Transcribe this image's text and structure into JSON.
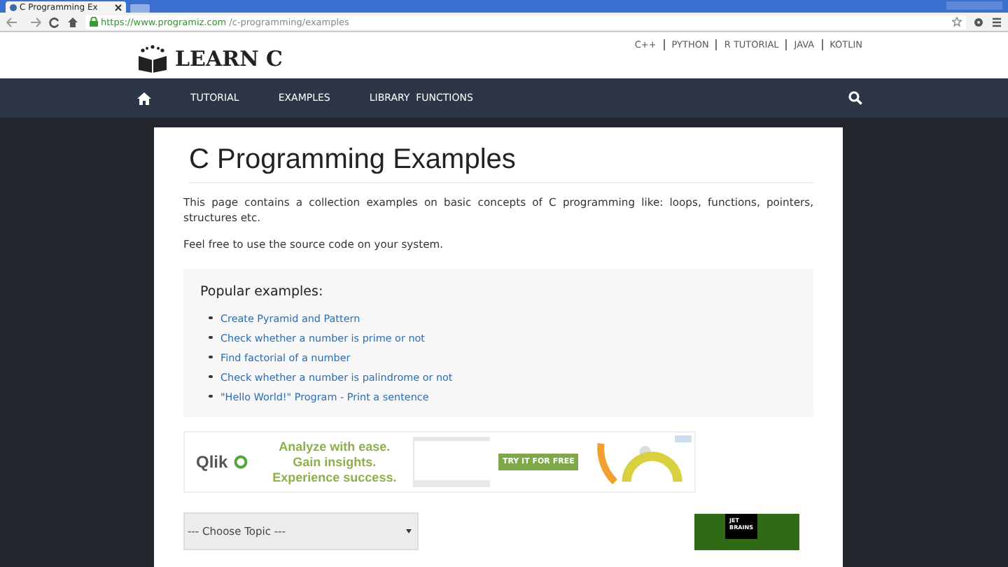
{
  "browser": {
    "tab_title": "C Programming Ex",
    "url_host": "https://www.programiz.com",
    "url_path": "/c-programming/examples"
  },
  "header": {
    "logo": "LEARN C",
    "top_links": [
      "C++",
      "PYTHON",
      "R TUTORIAL",
      "JAVA",
      "KOTLIN"
    ]
  },
  "nav": {
    "items": [
      "TUTORIAL",
      "EXAMPLES",
      "LIBRARY  FUNCTIONS"
    ]
  },
  "content": {
    "title": "C Programming Examples",
    "paragraphs": [
      "This page contains a collection examples on basic concepts of C programming like: loops, functions, pointers, structures etc.",
      "Feel free to use the source code on your system."
    ],
    "popular": {
      "heading": "Popular examples:",
      "links": [
        "Create Pyramid and Pattern",
        "Check whether a number is prime or not",
        "Find factorial of a number",
        "Check whether a number is palindrome or not",
        "\"Hello World!\" Program - Print a sentence"
      ]
    },
    "ad": {
      "brand": "Qlik",
      "lines": [
        "Analyze with ease.",
        "Gain insights.",
        "Experience success."
      ],
      "cta": "TRY IT FOR FREE"
    },
    "topic_select": {
      "value": "--- Choose Topic ---"
    },
    "side_ad": {
      "lines": [
        "JET",
        "BRAINS"
      ]
    }
  }
}
